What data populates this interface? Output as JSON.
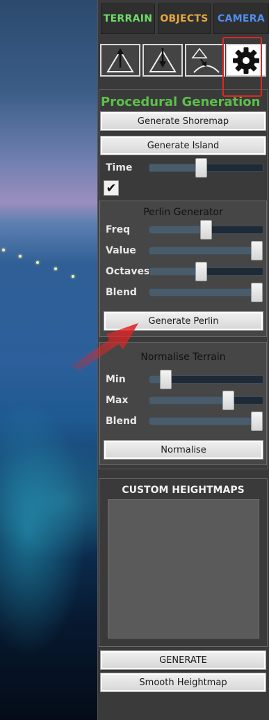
{
  "tabs": [
    {
      "label": "TERRAIN",
      "color": "#6fdc67"
    },
    {
      "label": "OBJECTS",
      "color": "#e7a740"
    },
    {
      "label": "CAMERA",
      "color": "#4f8ff0"
    }
  ],
  "tools": [
    {
      "icon": "raise-terrain-icon"
    },
    {
      "icon": "lower-terrain-icon"
    },
    {
      "icon": "smooth-terrain-icon"
    },
    {
      "icon": "gear-icon",
      "active": true
    }
  ],
  "procedural": {
    "heading": "Procedural Generation",
    "heading_color": "#5cc04a",
    "generate_shoremap": "Generate Shoremap",
    "generate_island": "Generate Island",
    "time_label": "Time",
    "time_value": 0.45,
    "checkbox_checked": true
  },
  "perlin": {
    "title": "Perlin Generator",
    "sliders": [
      {
        "label": "Freq",
        "value": 0.5
      },
      {
        "label": "Value",
        "value": 1.0
      },
      {
        "label": "Octaves",
        "value": 0.45
      },
      {
        "label": "Blend",
        "value": 1.0
      }
    ],
    "button": "Generate Perlin"
  },
  "normalise": {
    "title": "Normalise Terrain",
    "sliders": [
      {
        "label": "Min",
        "value": 0.1
      },
      {
        "label": "Max",
        "value": 0.72
      },
      {
        "label": "Blend",
        "value": 1.0
      }
    ],
    "button": "Normalise"
  },
  "custom": {
    "title": "CUSTOM HEIGHTMAPS"
  },
  "footer": {
    "generate": "GENERATE",
    "smooth": "Smooth Heightmap"
  },
  "annotations": {
    "highlight_color": "#e02525",
    "arrow_color": "#e02525"
  }
}
